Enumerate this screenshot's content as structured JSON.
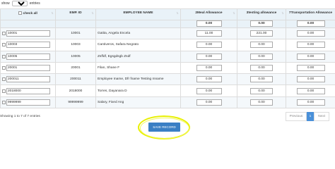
{
  "top": {
    "show_label": "show",
    "entries_value": "10",
    "entries_label": "entries"
  },
  "headers": {
    "check_all": "check all",
    "emp_id": "EMP. ID",
    "employee_name": "EMPLOYEE NAME",
    "meal": "2Meal Allowance",
    "testing": "3testing allowance",
    "transport": "7Transportation Allowance"
  },
  "header_defaults": {
    "meal": "0.00",
    "testing": "0.00",
    "transport": "0.00"
  },
  "rows": [
    {
      "box_id": "10001",
      "emp_id": "10001",
      "name": "Gatita, Angela Encela",
      "meal": "11.00",
      "testing": "221.00",
      "transport": "0.00"
    },
    {
      "box_id": "10003",
      "emp_id": "10003",
      "name": "Cantiveros, Safara Negrato",
      "meal": "0.00",
      "testing": "0.00",
      "transport": "0.00"
    },
    {
      "box_id": "10005",
      "emp_id": "10005",
      "name": "Zsffdf, Egsgdsgb Zsdf",
      "meal": "0.00",
      "testing": "0.00",
      "transport": "0.00"
    },
    {
      "box_id": "20001",
      "emp_id": "20001",
      "name": "Filan, Shane F",
      "meal": "0.00",
      "testing": "0.00",
      "transport": "0.00"
    },
    {
      "box_id": "200011",
      "emp_id": "200011",
      "name": "Employee Iname, Dfr fname Testing mname",
      "meal": "0.00",
      "testing": "0.00",
      "transport": "0.00"
    },
    {
      "box_id": "2018000",
      "emp_id": "2018000",
      "name": "Torres, Dayanara D",
      "meal": "0.00",
      "testing": "0.00",
      "transport": "0.00"
    },
    {
      "box_id": "9999999",
      "emp_id": "99999999",
      "name": "Salary, Fixed Ang",
      "meal": "0.00",
      "testing": "0.00",
      "transport": "0.00"
    }
  ],
  "info": "Showing 1 to 7 of 7 entries",
  "pagination": {
    "previous": "Previous",
    "page": "1",
    "next": "Next"
  },
  "save_label": "SAVE RECORD",
  "colors": {
    "header_bg": "#e9f2f8",
    "accent": "#3a7fc4",
    "highlight": "#e8f000"
  }
}
